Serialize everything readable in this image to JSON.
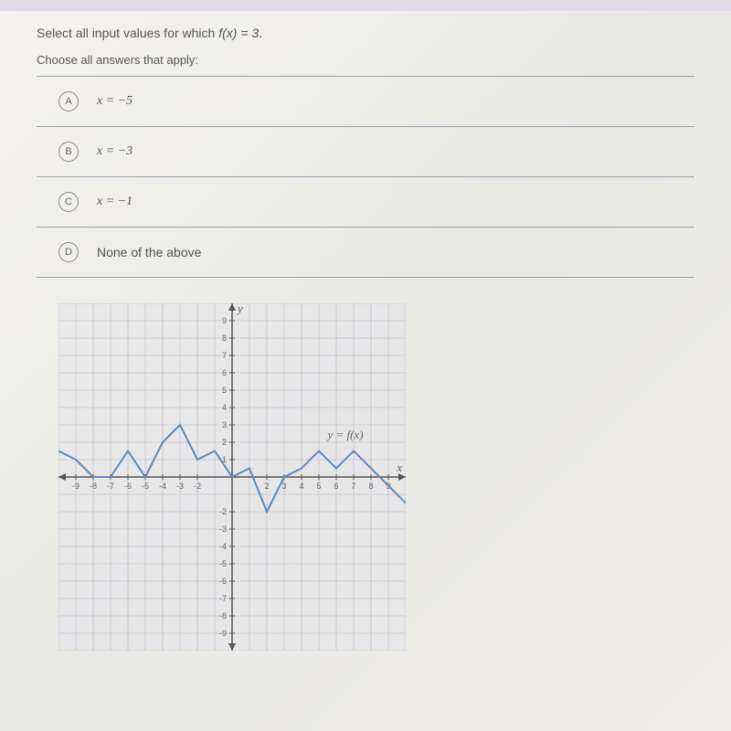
{
  "question": {
    "prefix": "Select all input values for which ",
    "expr": "f(x) = 3",
    "suffix": "."
  },
  "instruction": "Choose all answers that apply:",
  "choices": [
    {
      "letter": "A",
      "text": "x = −5",
      "math": true
    },
    {
      "letter": "B",
      "text": "x = −3",
      "math": true
    },
    {
      "letter": "C",
      "text": "x = −1",
      "math": true
    },
    {
      "letter": "D",
      "text": "None of the above",
      "math": false
    }
  ],
  "chart_data": {
    "type": "line",
    "title": "",
    "xlabel": "x",
    "ylabel": "y",
    "xlim": [
      -10,
      10
    ],
    "ylim": [
      -10,
      10
    ],
    "x_ticks": [
      -9,
      -8,
      -7,
      -6,
      -5,
      -4,
      -3,
      -2,
      2,
      3,
      4,
      5,
      6,
      7,
      8,
      9
    ],
    "y_ticks": [
      -9,
      -8,
      -7,
      -6,
      -5,
      -4,
      -3,
      -2,
      1,
      2,
      3,
      4,
      5,
      6,
      7,
      8,
      9
    ],
    "annotation": "y = f(x)",
    "series": [
      {
        "name": "f(x)",
        "points": [
          [
            -10,
            1.5
          ],
          [
            -9,
            1
          ],
          [
            -8,
            0
          ],
          [
            -7,
            0
          ],
          [
            -6,
            1.5
          ],
          [
            -5,
            0
          ],
          [
            -4,
            2
          ],
          [
            -3,
            3
          ],
          [
            -2,
            1
          ],
          [
            -1,
            1.5
          ],
          [
            0,
            0
          ],
          [
            1,
            0.5
          ],
          [
            2,
            -2
          ],
          [
            3,
            0
          ],
          [
            4,
            0.5
          ],
          [
            5,
            1.5
          ],
          [
            6,
            0.5
          ],
          [
            7,
            1.5
          ],
          [
            8,
            0.5
          ],
          [
            9,
            -0.5
          ],
          [
            10,
            -1.5
          ]
        ]
      }
    ]
  }
}
